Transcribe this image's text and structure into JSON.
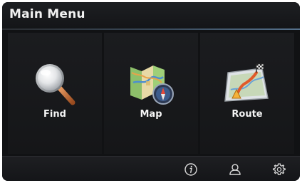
{
  "header": {
    "title": "Main Menu"
  },
  "tiles": [
    {
      "label": "Find",
      "icon": "magnifier-icon"
    },
    {
      "label": "Map",
      "icon": "folded-map-compass-icon"
    },
    {
      "label": "Route",
      "icon": "route-map-icon"
    }
  ],
  "toolbar": {
    "buttons": [
      {
        "icon": "info-icon"
      },
      {
        "icon": "user-profile-icon"
      },
      {
        "icon": "settings-gear-icon"
      }
    ]
  },
  "colors": {
    "background": "#111214",
    "accent_line": "#55718c",
    "text": "#f2f2f2"
  }
}
